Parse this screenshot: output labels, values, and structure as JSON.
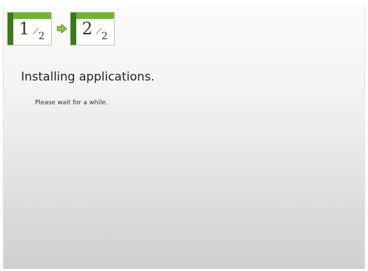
{
  "steps": [
    {
      "number": "1",
      "total": "2",
      "state": "done"
    },
    {
      "number": "2",
      "total": "2",
      "state": "current"
    }
  ],
  "icons": {
    "step_arrow": "right-arrow-icon"
  },
  "colors": {
    "accent_green": "#6cb72a",
    "dark_green": "#3a7a14"
  },
  "main": {
    "title": "Installing applications.",
    "message": "Please wait for a while."
  }
}
